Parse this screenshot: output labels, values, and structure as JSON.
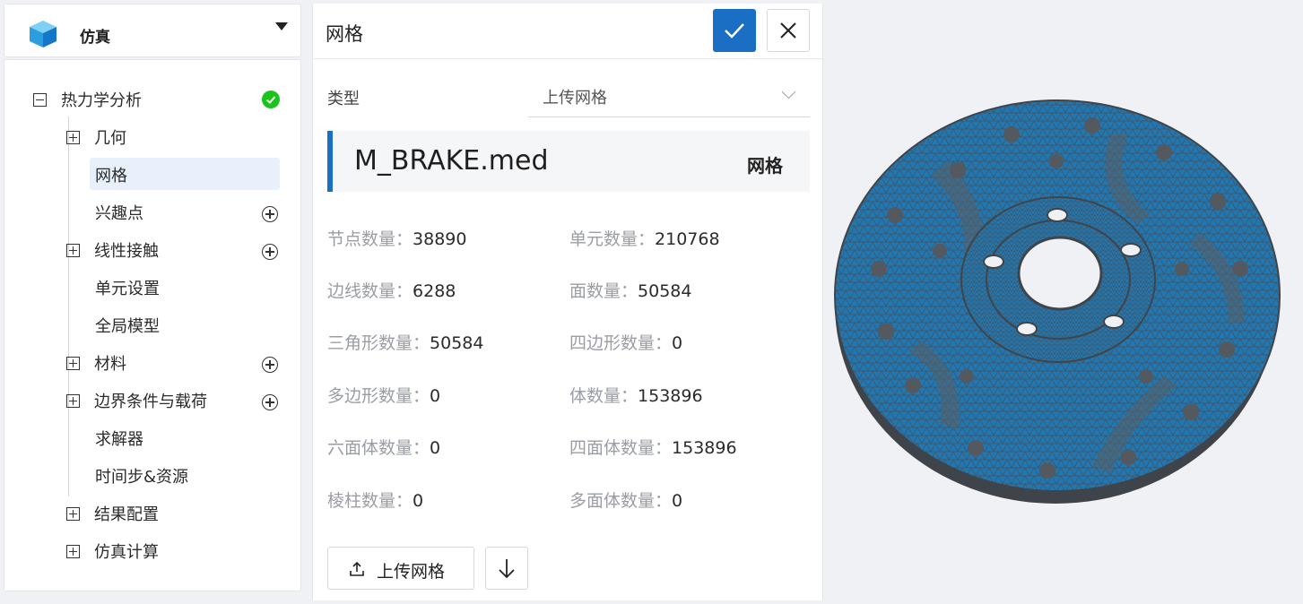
{
  "app": {
    "title": "仿真"
  },
  "tree": {
    "root": "热力学分析",
    "items": [
      {
        "label": "几何"
      },
      {
        "label": "网格"
      },
      {
        "label": "兴趣点"
      },
      {
        "label": "线性接触"
      },
      {
        "label": "单元设置"
      },
      {
        "label": "全局模型"
      },
      {
        "label": "材料"
      },
      {
        "label": "边界条件与载荷"
      },
      {
        "label": "求解器"
      },
      {
        "label": "时间步&资源"
      },
      {
        "label": "结果配置"
      },
      {
        "label": "仿真计算"
      }
    ],
    "selected": "网格",
    "status_color": "#1cc31c"
  },
  "mesh_panel": {
    "title": "网格",
    "type_label": "类型",
    "type_value": "上传网格",
    "file_name": "M_BRAKE.med",
    "file_tag": "网格",
    "accent_color": "#1a6fc4",
    "stats": [
      {
        "label": "节点数量：",
        "value": "38890"
      },
      {
        "label": "单元数量：",
        "value": "210768"
      },
      {
        "label": "边线数量：",
        "value": "6288"
      },
      {
        "label": "面数量：",
        "value": "50584"
      },
      {
        "label": "三角形数量：",
        "value": "50584"
      },
      {
        "label": "四边形数量：",
        "value": "0"
      },
      {
        "label": "多边形数量：",
        "value": "0"
      },
      {
        "label": "体数量：",
        "value": "153896"
      },
      {
        "label": "六面体数量：",
        "value": "0"
      },
      {
        "label": "四面体数量：",
        "value": "153896"
      },
      {
        "label": "棱柱数量：",
        "value": "0"
      },
      {
        "label": "多面体数量：",
        "value": "0"
      }
    ],
    "upload_label": "上传网格"
  },
  "viewer": {
    "mesh_color": "#1f78b4",
    "edge_color": "#4a4f55"
  }
}
